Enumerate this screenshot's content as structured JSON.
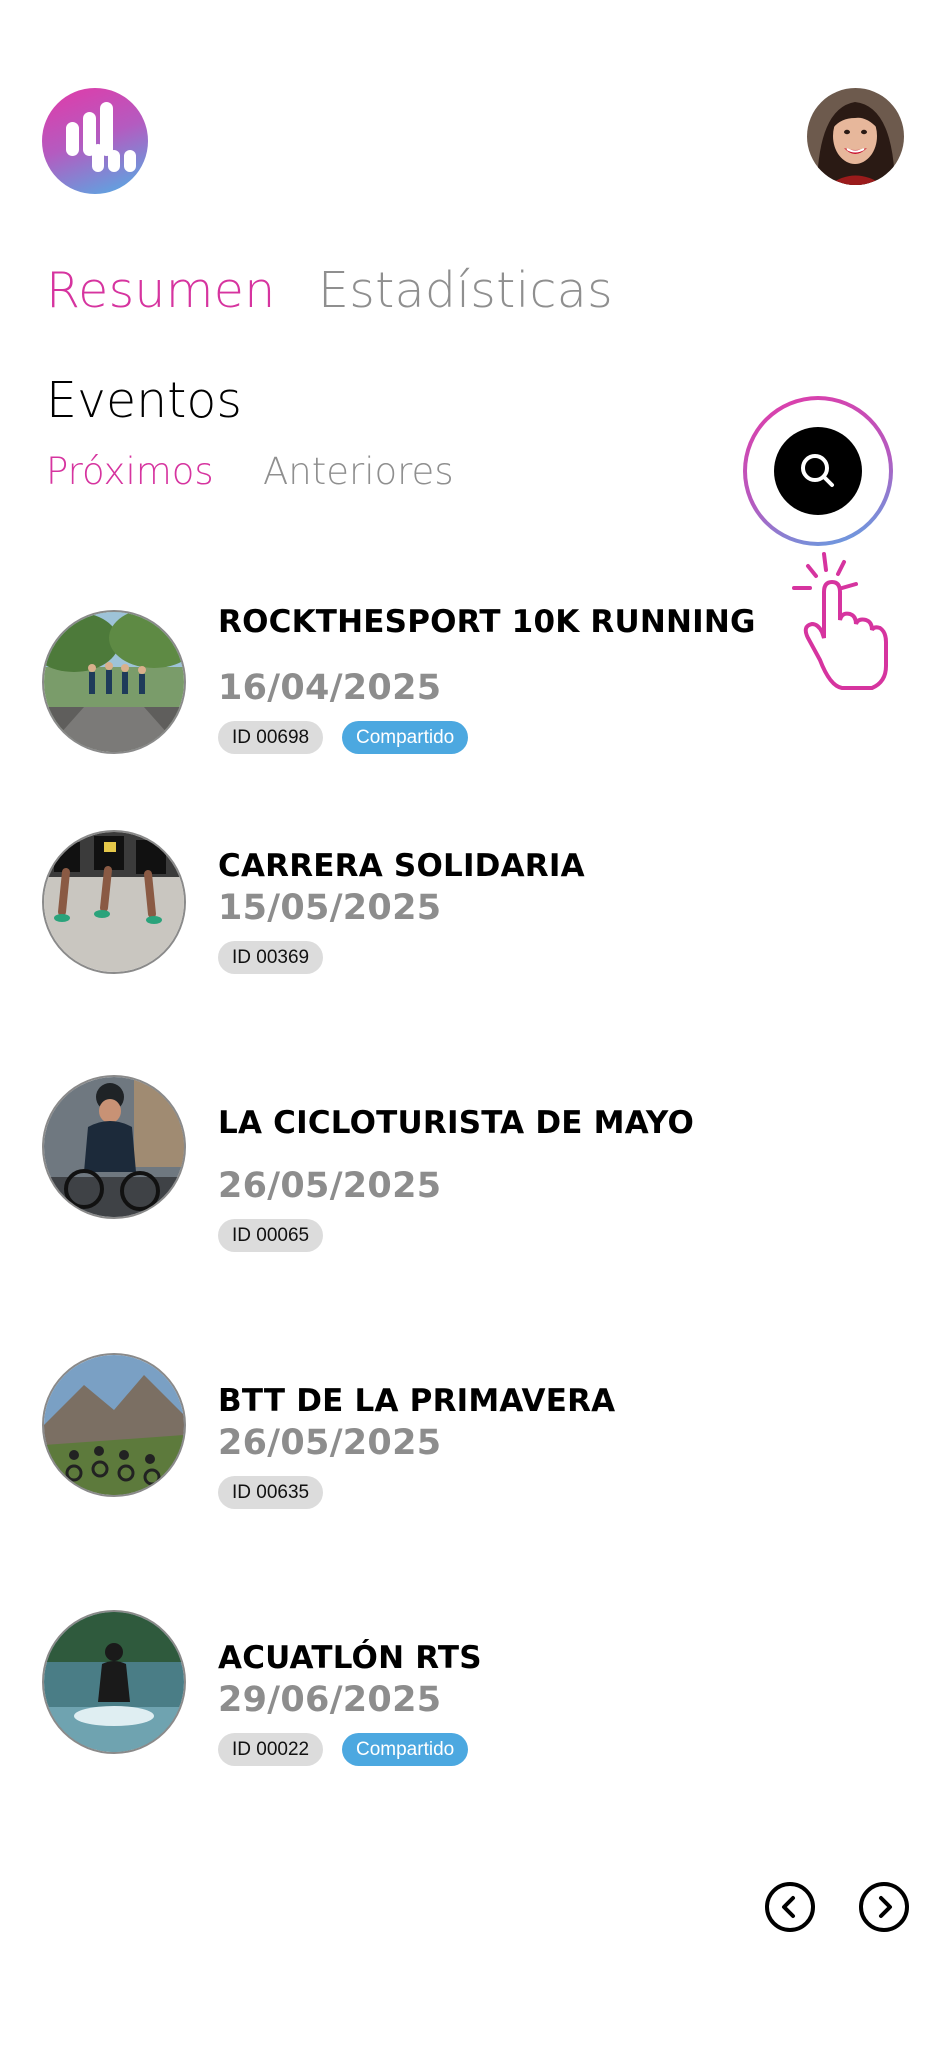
{
  "colors": {
    "accent": "#d6349f",
    "inactive": "#8f8f8f",
    "badge_id": "#dcdcdc",
    "badge_shared": "#4ca8e0"
  },
  "header": {
    "logo_icon": "app-logo-icon",
    "avatar_icon": "user-avatar"
  },
  "tabs": {
    "summary": "Resumen",
    "stats": "Estadísticas"
  },
  "events_section": {
    "title": "Eventos",
    "upcoming": "Próximos",
    "past": "Anteriores",
    "search_icon": "search-icon"
  },
  "events": [
    {
      "name": "ROCKTHESPORT 10K RUNNING",
      "date": "16/04/2025",
      "id": "ID 00698",
      "shared": "Compartido"
    },
    {
      "name": "CARRERA SOLIDARIA",
      "date": "15/05/2025",
      "id": "ID 00369"
    },
    {
      "name": "LA CICLOTURISTA DE MAYO",
      "date": "26/05/2025",
      "id": "ID 00065"
    },
    {
      "name": "BTT DE LA PRIMAVERA",
      "date": "26/05/2025",
      "id": "ID 00635"
    },
    {
      "name": "ACUATLÓN RTS",
      "date": "29/06/2025",
      "id": "ID 00022",
      "shared": "Compartido"
    }
  ],
  "pagination": {
    "prev_icon": "chevron-left-icon",
    "next_icon": "chevron-right-icon"
  }
}
